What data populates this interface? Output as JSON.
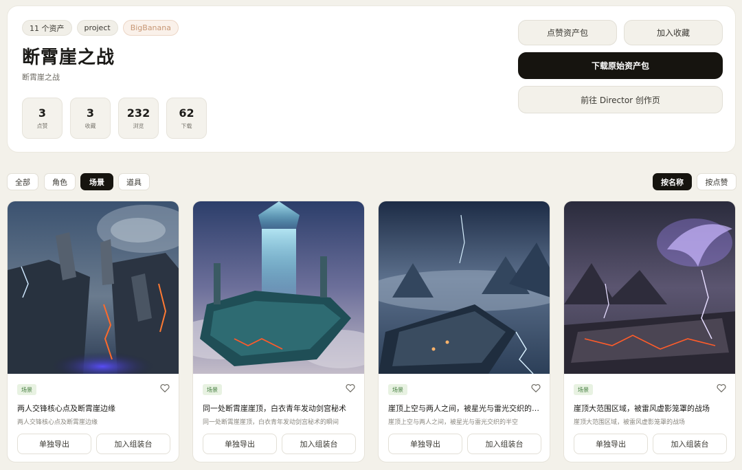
{
  "header": {
    "badges": [
      "11 个资产",
      "project",
      "BigBanana"
    ],
    "title": "断霄崖之战",
    "subtitle": "断霄崖之战",
    "stats": [
      {
        "value": "3",
        "label": "点赞"
      },
      {
        "value": "3",
        "label": "收藏"
      },
      {
        "value": "232",
        "label": "浏览"
      },
      {
        "value": "62",
        "label": "下载"
      }
    ],
    "actions": {
      "like": "点赞资产包",
      "favorite": "加入收藏",
      "download": "下载原始资产包",
      "director": "前往 Director 创作页"
    }
  },
  "filters": {
    "categories": [
      "全部",
      "角色",
      "场景",
      "道具"
    ],
    "active_category": "场景",
    "sorts": [
      "按名称",
      "按点赞"
    ],
    "active_sort": "按名称"
  },
  "cards": [
    {
      "tag": "场景",
      "title": "两人交锋核心点及断霄崖边缘",
      "desc": "两人交锋核心点及断霄崖边缘",
      "export": "单独导出",
      "assemble": "加入组装台",
      "icon": "heart-outline-icon"
    },
    {
      "tag": "场景",
      "title": "同一处断霄崖崖顶，白衣青年发动剑宫秘术",
      "desc": "同一处断霄崖崖顶，白衣青年发动剑宫秘术的瞬间",
      "export": "单独导出",
      "assemble": "加入组装台",
      "icon": "heart-outline-icon"
    },
    {
      "tag": "场景",
      "title": "崖顶上空与两人之间，被星光与雷光交织的半空",
      "desc": "崖顶上空与两人之间，被星光与雷光交织的半空",
      "export": "单独导出",
      "assemble": "加入组装台",
      "icon": "heart-outline-icon"
    },
    {
      "tag": "场景",
      "title": "崖顶大范围区域，被雷风虚影笼罩的战场",
      "desc": "崖顶大范围区域，被雷风虚影笼罩的战场",
      "export": "单独导出",
      "assemble": "加入组装台",
      "icon": "heart-outline-icon"
    }
  ],
  "colors": {
    "background": "#f3f1ea",
    "dark": "#16140f",
    "accent_badge": "#c79775",
    "tag_green": "#3f7a3a"
  }
}
